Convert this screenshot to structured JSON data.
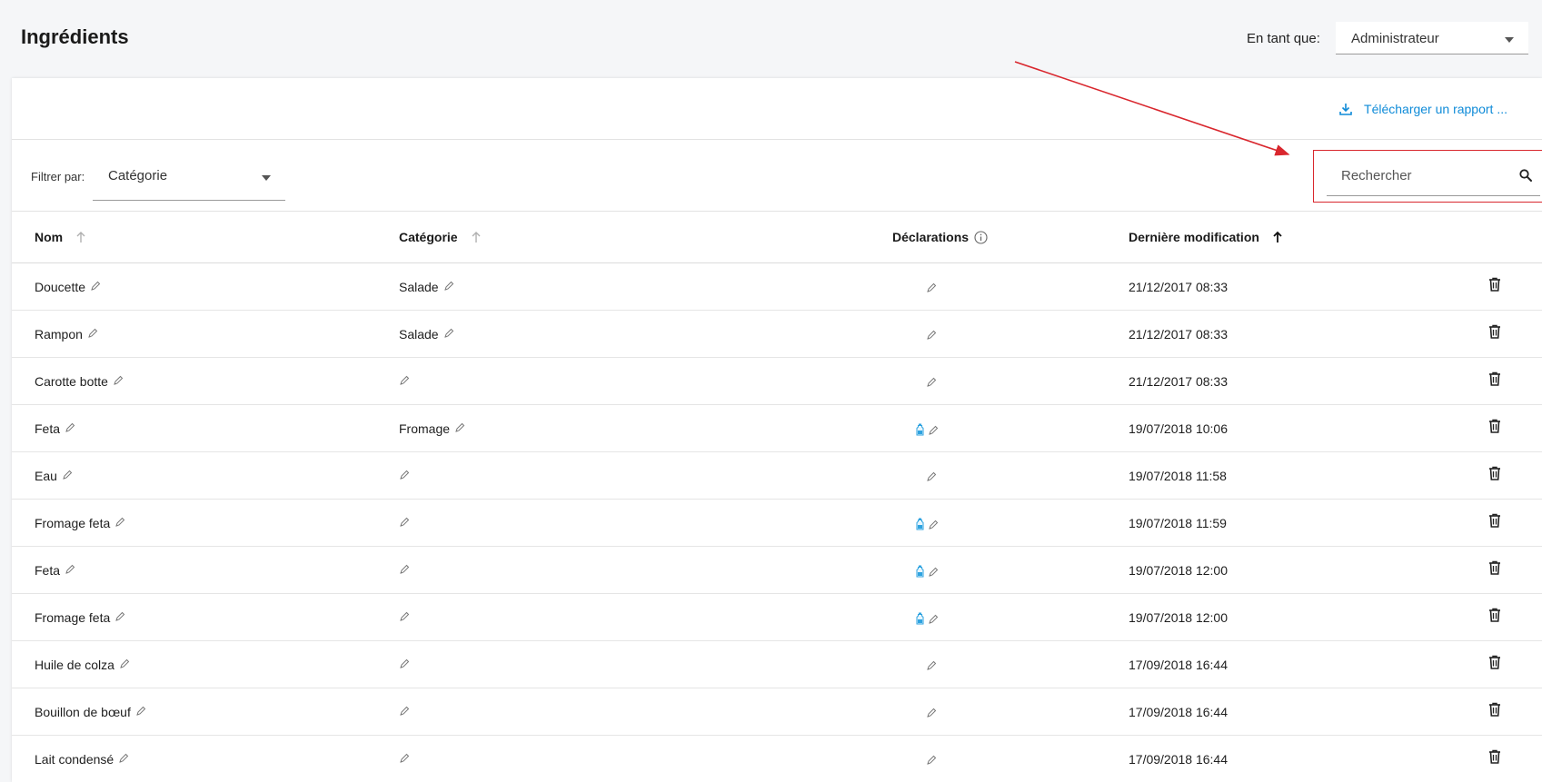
{
  "header": {
    "title": "Ingrédients",
    "role_label": "En tant que:",
    "role_value": "Administrateur"
  },
  "toolbar": {
    "download_label": "Télécharger un rapport ...",
    "filter_label": "Filtrer par:",
    "filter_value": "Catégorie",
    "search_placeholder": "Rechercher"
  },
  "table": {
    "columns": {
      "name": "Nom",
      "category": "Catégorie",
      "declarations": "Déclarations",
      "modified": "Dernière modification"
    },
    "rows": [
      {
        "name": "Doucette",
        "category": "Salade",
        "declaration_icon": "",
        "modified": "21/12/2017 08:33"
      },
      {
        "name": "Rampon",
        "category": "Salade",
        "declaration_icon": "",
        "modified": "21/12/2017 08:33"
      },
      {
        "name": "Carotte botte",
        "category": "",
        "declaration_icon": "",
        "modified": "21/12/2017 08:33"
      },
      {
        "name": "Feta",
        "category": "Fromage",
        "declaration_icon": "bottle-icon",
        "modified": "19/07/2018 10:06"
      },
      {
        "name": "Eau",
        "category": "",
        "declaration_icon": "",
        "modified": "19/07/2018 11:58"
      },
      {
        "name": "Fromage feta",
        "category": "",
        "declaration_icon": "bottle-icon",
        "modified": "19/07/2018 11:59"
      },
      {
        "name": "Feta",
        "category": "",
        "declaration_icon": "bottle-icon",
        "modified": "19/07/2018 12:00"
      },
      {
        "name": "Fromage feta",
        "category": "",
        "declaration_icon": "bottle-icon",
        "modified": "19/07/2018 12:00"
      },
      {
        "name": "Huile de colza",
        "category": "",
        "declaration_icon": "",
        "modified": "17/09/2018 16:44"
      },
      {
        "name": "Bouillon de bœuf",
        "category": "",
        "declaration_icon": "",
        "modified": "17/09/2018 16:44"
      },
      {
        "name": "Lait condensé",
        "category": "",
        "declaration_icon": "",
        "modified": "17/09/2018 16:44"
      }
    ]
  },
  "colors": {
    "accent": "#0f8bd8",
    "annotation": "#d9272e",
    "bottle": "#2fa3e0"
  }
}
